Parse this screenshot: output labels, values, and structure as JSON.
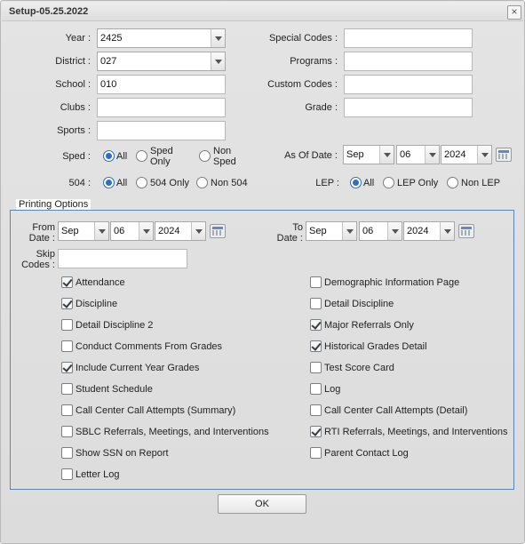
{
  "window": {
    "title": "Setup-05.25.2022",
    "close_glyph": "×"
  },
  "fields": {
    "year": {
      "label": "Year :",
      "value": "2425"
    },
    "district": {
      "label": "District :",
      "value": "027"
    },
    "school": {
      "label": "School :",
      "value": "010"
    },
    "clubs": {
      "label": "Clubs :",
      "value": ""
    },
    "sports": {
      "label": "Sports :",
      "value": ""
    },
    "special_codes": {
      "label": "Special Codes :",
      "value": ""
    },
    "programs": {
      "label": "Programs :",
      "value": ""
    },
    "custom_codes": {
      "label": "Custom Codes :",
      "value": ""
    },
    "grade": {
      "label": "Grade :",
      "value": ""
    }
  },
  "sped": {
    "label": "Sped :",
    "options": [
      "All",
      "Sped Only",
      "Non Sped"
    ],
    "option_lines": [
      [
        "All"
      ],
      [
        "Sped",
        "Only"
      ],
      [
        "Non",
        "Sped"
      ]
    ],
    "selected": "All"
  },
  "f504": {
    "label": "504 :",
    "options": [
      "All",
      "504 Only",
      "Non 504"
    ],
    "selected": "All"
  },
  "as_of_date": {
    "label": "As Of Date :",
    "month": "Sep",
    "day": "06",
    "year": "2024"
  },
  "lep": {
    "label": "LEP :",
    "options": [
      "All",
      "LEP Only",
      "Non LEP"
    ],
    "selected": "All"
  },
  "printing_options": {
    "legend": "Printing Options",
    "from_date": {
      "label_line1": "From",
      "label_line2": "Date :",
      "month": "Sep",
      "day": "06",
      "year": "2024"
    },
    "to_date": {
      "label_line1": "To",
      "label_line2": "Date :",
      "month": "Sep",
      "day": "06",
      "year": "2024"
    },
    "skip_codes": {
      "label_line1": "Skip",
      "label_line2": "Codes :",
      "value": ""
    },
    "left_checks": [
      {
        "label": "Attendance",
        "checked": true
      },
      {
        "label": "Discipline",
        "checked": true
      },
      {
        "label": "Detail Discipline 2",
        "checked": false
      },
      {
        "label": "Conduct Comments From Grades",
        "checked": false
      },
      {
        "label": "Include Current Year Grades",
        "checked": true
      },
      {
        "label": "Student Schedule",
        "checked": false
      },
      {
        "label": "Call Center Call Attempts (Summary)",
        "checked": false
      },
      {
        "label": "SBLC Referrals, Meetings, and Interventions",
        "checked": false
      },
      {
        "label": "Show SSN on Report",
        "checked": false
      },
      {
        "label": "Letter Log",
        "checked": false
      }
    ],
    "right_checks": [
      {
        "label": "Demographic Information Page",
        "checked": false
      },
      {
        "label": "Detail Discipline",
        "checked": false
      },
      {
        "label": "Major Referrals Only",
        "checked": true
      },
      {
        "label": "Historical Grades Detail",
        "checked": true
      },
      {
        "label": "Test Score Card",
        "checked": false
      },
      {
        "label": "Log",
        "checked": false
      },
      {
        "label": "Call Center Call Attempts (Detail)",
        "checked": false
      },
      {
        "label": "RTI Referrals, Meetings, and Interventions",
        "checked": true
      },
      {
        "label": "Parent Contact Log",
        "checked": false
      }
    ]
  },
  "ok_button": {
    "label": "OK"
  }
}
